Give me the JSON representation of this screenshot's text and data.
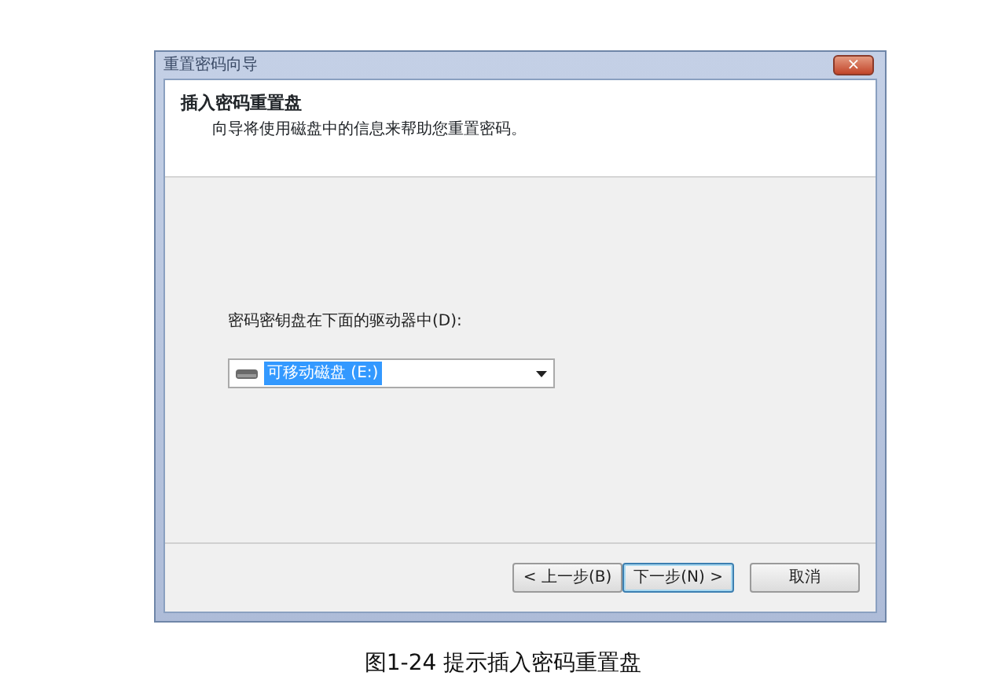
{
  "window": {
    "title": "重置密码向导",
    "close": "×"
  },
  "header": {
    "title": "插入密码重置盘",
    "subtitle": "向导将使用磁盘中的信息来帮助您重置密码。"
  },
  "drive_label": "密码密钥盘在下面的驱动器中(D):",
  "drive_select": {
    "value": "可移动磁盘 (E:)",
    "highlighted": true
  },
  "buttons": [
    {
      "label": "< 上一步(B)",
      "default": false
    },
    {
      "label": "下一步(N) >",
      "default": true
    },
    {
      "label": "取消",
      "default": false
    }
  ],
  "caption": "图1-24 提示插入密码重置盘"
}
